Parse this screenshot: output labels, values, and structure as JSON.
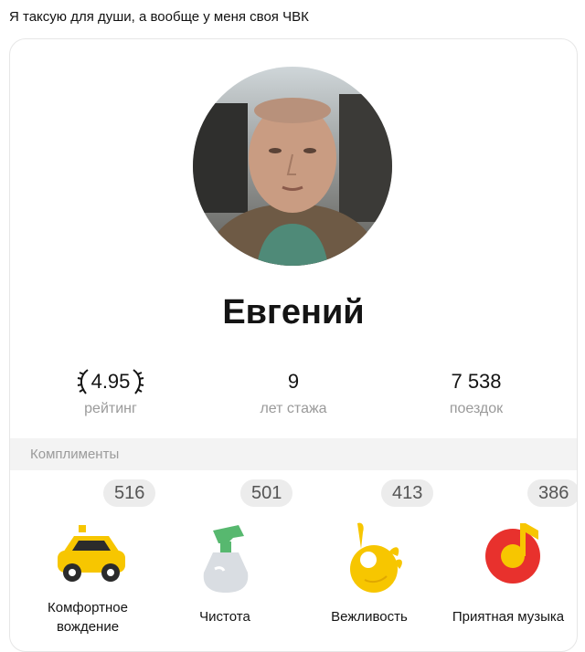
{
  "post": {
    "caption": "Я таксую для души, а вообще у меня своя ЧВК"
  },
  "profile": {
    "name": "Евгений"
  },
  "stats": [
    {
      "value": "4.95",
      "label": "рейтинг"
    },
    {
      "value": "9",
      "label": "лет стажа"
    },
    {
      "value": "7 538",
      "label": "поездок"
    }
  ],
  "compliments": {
    "title": "Комплименты",
    "items": [
      {
        "count": "516",
        "label": "Комфортное вождение",
        "icon": "taxi-car-icon"
      },
      {
        "count": "501",
        "label": "Чистота",
        "icon": "spray-bottle-icon"
      },
      {
        "count": "413",
        "label": "Вежливость",
        "icon": "ok-hand-icon"
      },
      {
        "count": "386",
        "label": "Приятная музыка",
        "icon": "music-note-icon"
      }
    ]
  },
  "colors": {
    "taxi_yellow": "#f7c600",
    "music_red": "#e8312d",
    "badge_bg": "#ececec"
  }
}
